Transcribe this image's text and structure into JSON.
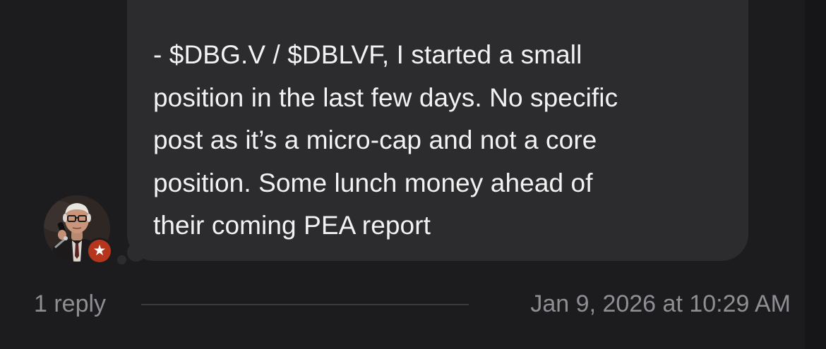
{
  "message": {
    "text": "- $DBG.V / $DBLVF, I started a small\nposition in the last few days. No specific\npost as it’s a micro-cap and not a core\nposition. Some lunch money ahead of\ntheir coming PEA report"
  },
  "author": {
    "avatar_icon": "user-photo-avatar",
    "badge_icon": "star-icon",
    "badge_color": "#b5361c"
  },
  "footer": {
    "reply_count": "1 reply",
    "timestamp": "Jan 9, 2026 at 10:29 AM"
  },
  "colors": {
    "background": "#1c1c1e",
    "bubble": "#2c2c2e",
    "text": "#f2f2f2",
    "muted_text": "#8e8e93"
  }
}
